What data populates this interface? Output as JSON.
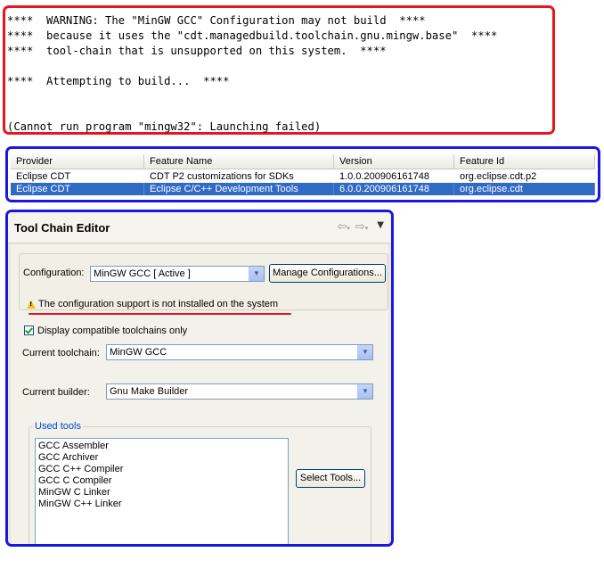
{
  "console": {
    "lines": [
      "****  WARNING: The \"MinGW GCC\" Configuration may not build  ****",
      "****  because it uses the \"cdt.managedbuild.toolchain.gnu.mingw.base\"  ****",
      "****  tool-chain that is unsupported on this system.  ****",
      "",
      "****  Attempting to build...  ****",
      "",
      "",
      "(Cannot run program \"mingw32\": Launching failed)"
    ]
  },
  "features": {
    "headers": [
      "Provider",
      "Feature Name",
      "Version",
      "Feature Id"
    ],
    "rows": [
      [
        "Eclipse CDT",
        "CDT P2 customizations for SDKs",
        "1.0.0.200906161748",
        "org.eclipse.cdt.p2"
      ],
      [
        "Eclipse CDT",
        "Eclipse C/C++ Development Tools",
        "6.0.0.200906161748",
        "org.eclipse.cdt"
      ]
    ],
    "selected_row": 1
  },
  "editor": {
    "title": "Tool Chain Editor",
    "nav": {
      "back_icon": "back-arrow-icon",
      "forward_icon": "forward-arrow-icon",
      "menu_icon": "view-menu-icon"
    },
    "configuration_label": "Configuration:",
    "configuration_value": "MinGW GCC  [ Active ]",
    "manage_button": "Manage Configurations...",
    "warning": "The configuration support is not installed on the system",
    "compatible_label": "Display compatible toolchains only",
    "compatible_checked": true,
    "toolchain_label": "Current toolchain:",
    "toolchain_value": "MinGW GCC",
    "builder_label": "Current builder:",
    "builder_value": "Gnu Make Builder",
    "used_tools_label": "Used tools",
    "tools": [
      "GCC Assembler",
      "GCC Archiver",
      "GCC C++ Compiler",
      "GCC C Compiler",
      "MinGW C Linker",
      "MinGW C++ Linker"
    ],
    "select_tools_button": "Select Tools..."
  },
  "colors": {
    "highlight_red": "#e8141c",
    "highlight_blue": "#1a17e4",
    "selection": "#316ac5"
  }
}
